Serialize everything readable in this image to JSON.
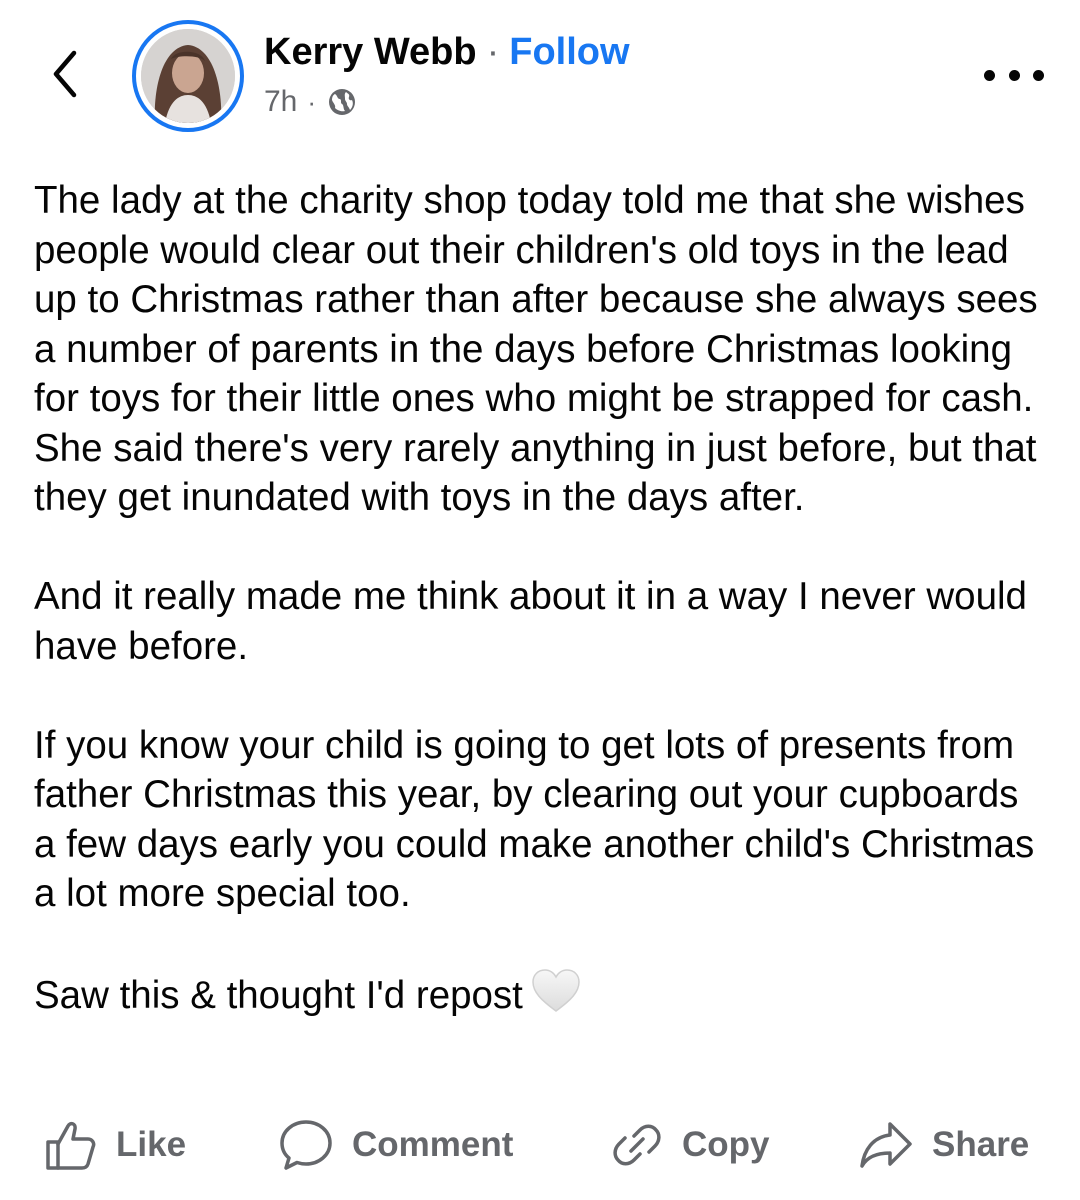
{
  "header": {
    "author_name": "Kerry Webb",
    "separator": "·",
    "follow_label": "Follow",
    "timestamp": "7h",
    "meta_separator": "·",
    "audience_icon": "globe-icon",
    "back_icon": "chevron-left-icon",
    "more_icon": "ellipsis-icon"
  },
  "post": {
    "paragraphs": [
      "The lady at the charity shop today told me that she wishes people would clear out their children's old toys in the lead up to Christmas rather than after because she always sees a number of parents in the days before Christmas looking for toys for their little ones who might be strapped for cash. She said there's very rarely anything in just before, but that they get inundated with toys in the days after.",
      "And it really made me think about it in a way I never would have before.",
      "If you know your child is going to get lots of presents from father Christmas this year, by clearing out your cupboards a few days early you could make another child's Christmas a lot more special too.",
      "Saw this & thought I'd repost"
    ],
    "trailing_emoji": "white-heart-icon"
  },
  "actions": {
    "like_label": "Like",
    "comment_label": "Comment",
    "copy_label": "Copy",
    "share_label": "Share"
  },
  "colors": {
    "accent": "#1877f2",
    "text": "#050505",
    "secondary_text": "#65676b"
  }
}
